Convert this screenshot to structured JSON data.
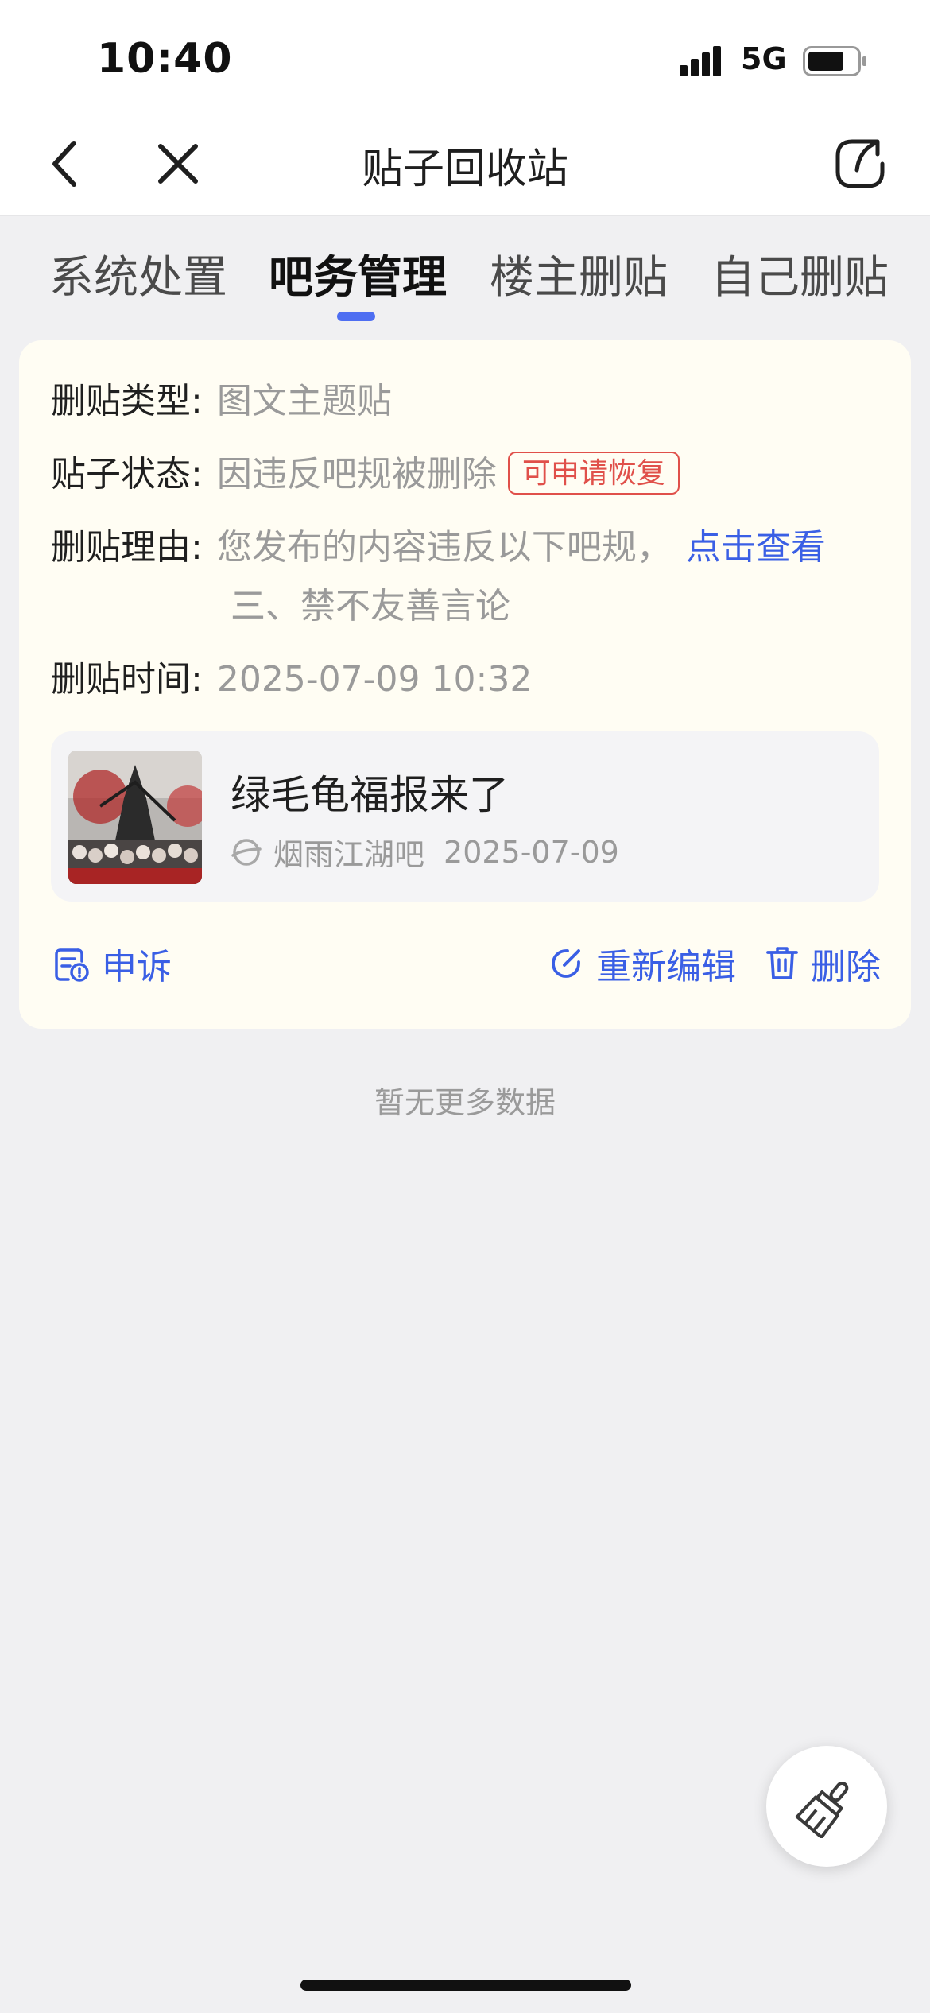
{
  "status_bar": {
    "time": "10:40",
    "network": "5G"
  },
  "nav": {
    "title": "贴子回收站"
  },
  "tabs": [
    {
      "label": "系统处置",
      "active": false
    },
    {
      "label": "吧务管理",
      "active": true
    },
    {
      "label": "楼主删贴",
      "active": false
    },
    {
      "label": "自己删贴",
      "active": false
    }
  ],
  "record": {
    "type_label": "删贴类型:",
    "type_value": "图文主题贴",
    "status_label": "贴子状态:",
    "status_value": "因违反吧规被删除",
    "status_badge": "可申请恢复",
    "reason_label": "删贴理由:",
    "reason_value": "您发布的内容违反以下吧规，",
    "reason_link": "点击查看",
    "reason_detail": "三、禁不友善言论",
    "time_label": "删贴时间:",
    "time_value": "2025-07-09 10:32",
    "post": {
      "title": "绿毛龟福报来了",
      "forum": "烟雨江湖吧",
      "date": "2025-07-09"
    },
    "actions": {
      "appeal": "申诉",
      "reedit": "重新编辑",
      "delete": "删除"
    }
  },
  "footer_text": "暂无更多数据",
  "colors": {
    "accent": "#3a5fe5",
    "badge": "#e0504a",
    "card_bg": "#fffdf3"
  }
}
